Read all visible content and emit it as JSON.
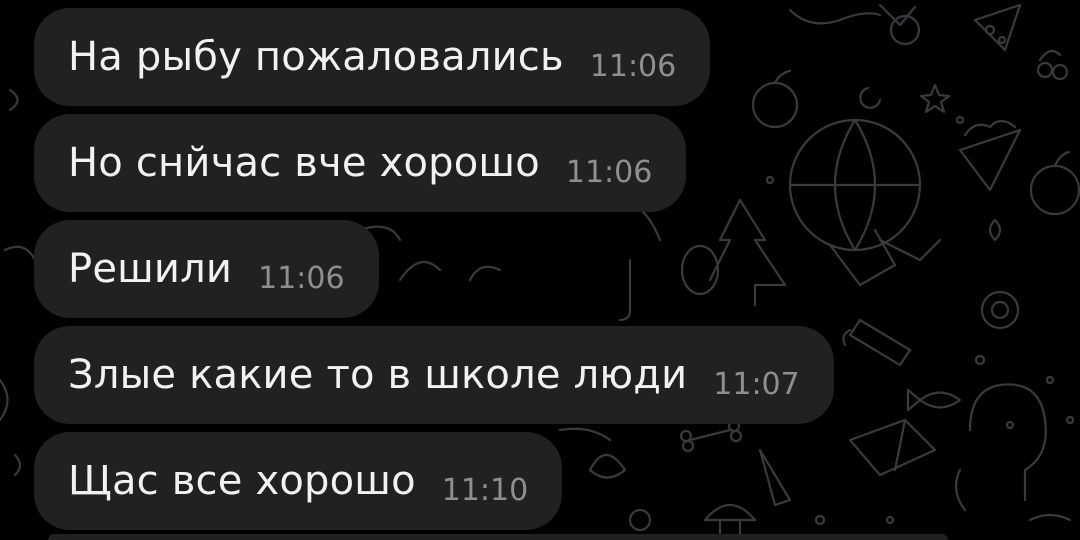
{
  "messages": [
    {
      "text": "На рыбу пожаловались",
      "time": "11:06"
    },
    {
      "text": "Но снйчас вче хорошо",
      "time": "11:06"
    },
    {
      "text": "Решили",
      "time": "11:06"
    },
    {
      "text": "Злые какие то в школе люди",
      "time": "11:07"
    },
    {
      "text": "Щас все хорошо",
      "time": "11:10"
    }
  ],
  "colors": {
    "background": "#000000",
    "bubble": "#212121",
    "text": "#f2f2f2",
    "time": "#8e8e93",
    "doodle": "#3a3a3e"
  }
}
